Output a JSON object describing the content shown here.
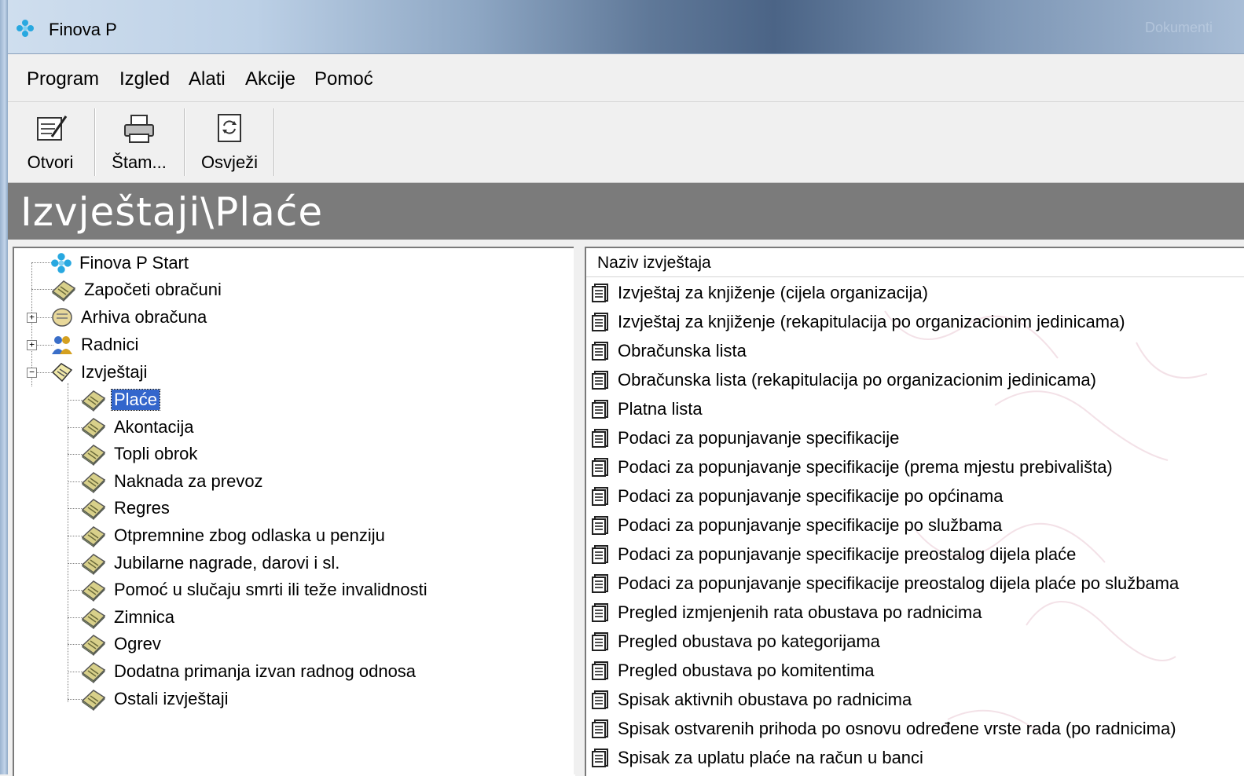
{
  "window": {
    "title": "Finova P",
    "right_hint": "Dokumenti"
  },
  "menu": [
    "Program",
    "Izgled",
    "Alati",
    "Akcije",
    "Pomoć"
  ],
  "toolbar": {
    "open_label": "Otvori",
    "print_label": "Štam...",
    "refresh_label": "Osvježi"
  },
  "header": {
    "title": "Izvještaji\\Plaće"
  },
  "tree": {
    "root": "Finova P Start",
    "items": [
      "Započeti obračuni",
      "Arhiva obračuna",
      "Radnici",
      "Izvještaji"
    ],
    "children": [
      "Plaće",
      "Akontacija",
      "Topli obrok",
      "Naknada za prevoz",
      "Regres",
      "Otpremnine zbog odlaska u penziju",
      "Jubilarne nagrade, darovi i sl.",
      "Pomoć u slučaju smrti ili teže invalidnosti",
      "Zimnica",
      "Ogrev",
      "Dodatna primanja izvan radnog odnosa",
      "Ostali izvještaji"
    ],
    "selected": "Plaće"
  },
  "list": {
    "column": "Naziv izvještaja",
    "rows": [
      "Izvještaj za knjiženje (cijela organizacija)",
      "Izvještaj za knjiženje (rekapitulacija po organizacionim jedinicama)",
      "Obračunska lista",
      "Obračunska lista (rekapitulacija po organizacionim jedinicama)",
      "Platna lista",
      "Podaci za popunjavanje specifikacije",
      "Podaci za popunjavanje specifikacije (prema mjestu prebivališta)",
      "Podaci za popunjavanje specifikacije po općinama",
      "Podaci za popunjavanje specifikacije po službama",
      "Podaci za popunjavanje specifikacije preostalog dijela plaće",
      "Podaci za popunjavanje specifikacije preostalog dijela plaće po službama",
      "Pregled izmjenjenih rata obustava po radnicima",
      "Pregled obustava po kategorijama",
      "Pregled obustava po komitentima",
      "Spisak aktivnih obustava po radnicima",
      "Spisak ostvarenih prihoda po osnovu određene vrste rada (po radnicima)",
      "Spisak za uplatu plaće na račun u banci"
    ]
  }
}
